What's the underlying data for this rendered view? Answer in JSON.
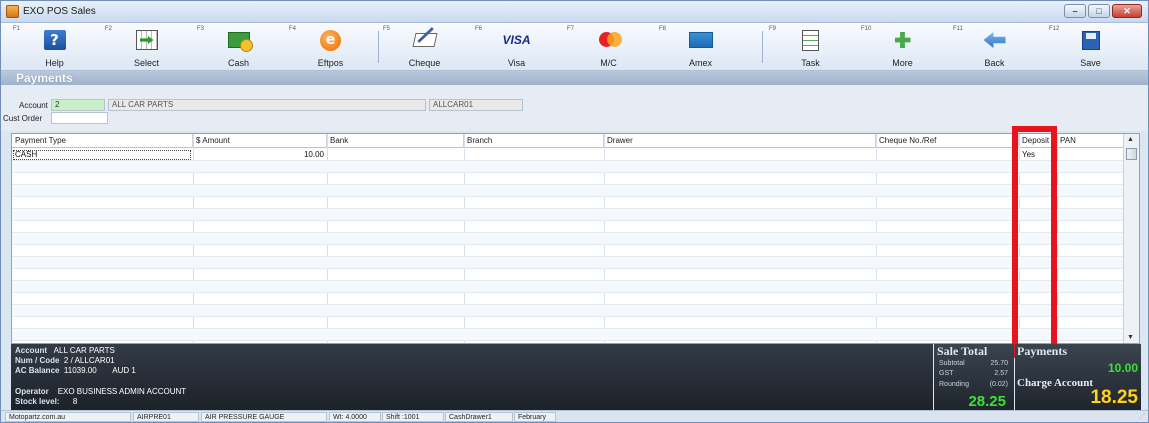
{
  "window": {
    "title": "EXO POS Sales"
  },
  "toolbar": {
    "buttons": [
      {
        "key": "F1",
        "label": "Help",
        "icon": "help-icon"
      },
      {
        "key": "F2",
        "label": "Select",
        "icon": "select-icon"
      },
      {
        "key": "F3",
        "label": "Cash",
        "icon": "cash-icon"
      },
      {
        "key": "F4",
        "label": "Eftpos",
        "icon": "eftpos-icon"
      },
      {
        "key": "F5",
        "label": "Cheque",
        "icon": "cheque-icon"
      },
      {
        "key": "F6",
        "label": "Visa",
        "icon": "visa-icon",
        "icon_text": "VISA"
      },
      {
        "key": "F7",
        "label": "M/C",
        "icon": "mastercard-icon"
      },
      {
        "key": "F8",
        "label": "Amex",
        "icon": "amex-icon"
      },
      {
        "key": "F9",
        "label": "Task",
        "icon": "task-icon"
      },
      {
        "key": "F10",
        "label": "More",
        "icon": "more-icon"
      },
      {
        "key": "F11",
        "label": "Back",
        "icon": "back-icon"
      },
      {
        "key": "F12",
        "label": "Save",
        "icon": "save-icon"
      }
    ]
  },
  "section": {
    "title": "Payments"
  },
  "account": {
    "label": "Account",
    "number": "2",
    "name": "ALL CAR PARTS",
    "code": "ALLCAR01",
    "cust_order_label": "Cust Order",
    "cust_order_value": ""
  },
  "grid": {
    "columns": [
      "Payment Type",
      "$ Amount",
      "Bank",
      "Branch",
      "Drawer",
      "Cheque No./Ref",
      "Deposit",
      "PAN"
    ],
    "rows": [
      {
        "payment_type": "CASH",
        "amount": "10.00",
        "bank": "",
        "branch": "",
        "drawer": "",
        "cheque_ref": "",
        "deposit": "Yes",
        "pan": ""
      }
    ]
  },
  "info": {
    "account_label": "Account",
    "account_value": "ALL CAR PARTS",
    "num_code_label": "Num / Code",
    "num_code_value": "2 / ALLCAR01",
    "ac_balance_label": "AC Balance",
    "ac_balance_value": "11039.00",
    "currency": "AUD 1",
    "operator_label": "Operator",
    "operator_value": "EXO BUSINESS ADMIN ACCOUNT",
    "stock_label": "Stock level:",
    "stock_value": "8"
  },
  "sale_total": {
    "title": "Sale Total",
    "subtotal_label": "Subtotal",
    "subtotal": "25.70",
    "gst_label": "GST",
    "gst": "2.57",
    "rounding_label": "Rounding",
    "rounding": "(0.02)",
    "total": "28.25"
  },
  "payments_panel": {
    "title": "Payments",
    "amount": "10.00",
    "charge_label": "Charge Account",
    "charge_amount": "18.25"
  },
  "status": {
    "site": "Motopartz.com.au",
    "code": "AIRPRE01",
    "description": "AIR PRESSURE GAUGE",
    "weight": "Wt: 4.0000",
    "shift": "Shift :1001",
    "drawer": "CashDrawer1",
    "period": "February"
  },
  "colors": {
    "highlight_border": "#e8141b",
    "total_green": "#3be03b",
    "charge_yellow": "#ffd21e"
  }
}
